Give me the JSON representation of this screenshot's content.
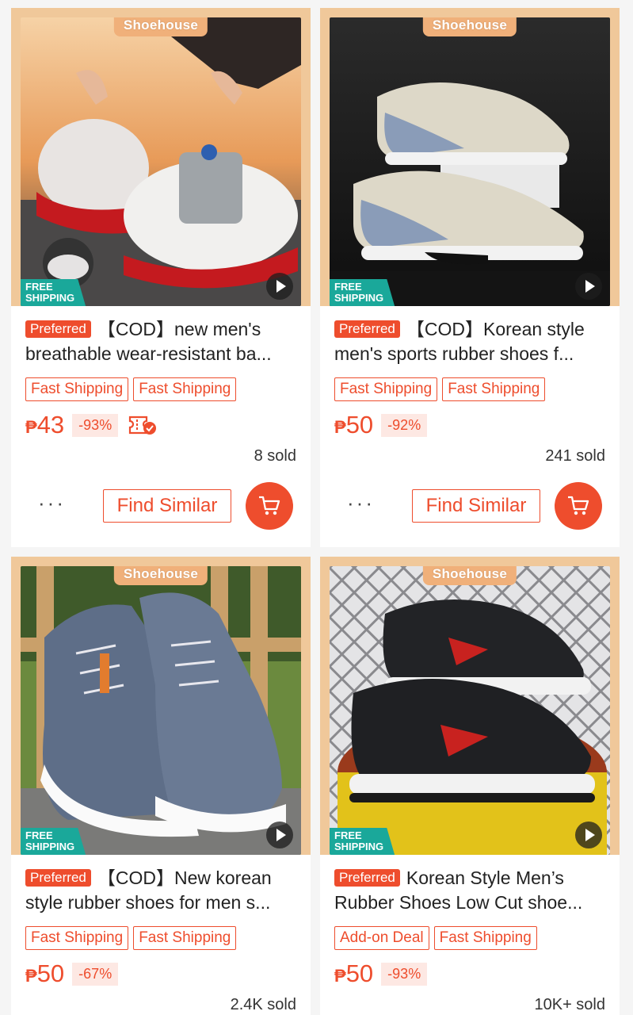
{
  "products": [
    {
      "shop_tag": "Shoehouse",
      "free_shipping_line1": "FREE",
      "free_shipping_line2": "SHIPPING",
      "preferred": "Preferred",
      "title": "【COD】new men's breathable wear-resistant ba...",
      "badges": [
        "Fast Shipping",
        "Fast Shipping"
      ],
      "currency": "₱",
      "price": "43",
      "discount": "-93%",
      "has_voucher_icon": true,
      "sold": "8 sold",
      "more": "···",
      "find_similar": "Find Similar"
    },
    {
      "shop_tag": "Shoehouse",
      "free_shipping_line1": "FREE",
      "free_shipping_line2": "SHIPPING",
      "preferred": "Preferred",
      "title": "【COD】Korean style men's sports rubber shoes f...",
      "badges": [
        "Fast Shipping",
        "Fast Shipping"
      ],
      "currency": "₱",
      "price": "50",
      "discount": "-92%",
      "has_voucher_icon": false,
      "sold": "241 sold",
      "more": "···",
      "find_similar": "Find Similar"
    },
    {
      "shop_tag": "Shoehouse",
      "free_shipping_line1": "FREE",
      "free_shipping_line2": "SHIPPING",
      "preferred": "Preferred",
      "title": "【COD】New korean style rubber shoes for men s...",
      "badges": [
        "Fast Shipping",
        "Fast Shipping"
      ],
      "currency": "₱",
      "price": "50",
      "discount": "-67%",
      "has_voucher_icon": false,
      "sold": "2.4K sold"
    },
    {
      "shop_tag": "Shoehouse",
      "free_shipping_line1": "FREE",
      "free_shipping_line2": "SHIPPING",
      "preferred": "Preferred",
      "title": "Korean Style Men’s Rubber Shoes Low Cut shoe...",
      "badges": [
        "Add-on Deal",
        "Fast Shipping"
      ],
      "currency": "₱",
      "price": "50",
      "discount": "-93%",
      "has_voucher_icon": false,
      "sold": "10K+ sold"
    }
  ],
  "colors": {
    "accent": "#ee4d2d",
    "free_shipping": "#1aa89a",
    "frame": "#f0c89a"
  }
}
